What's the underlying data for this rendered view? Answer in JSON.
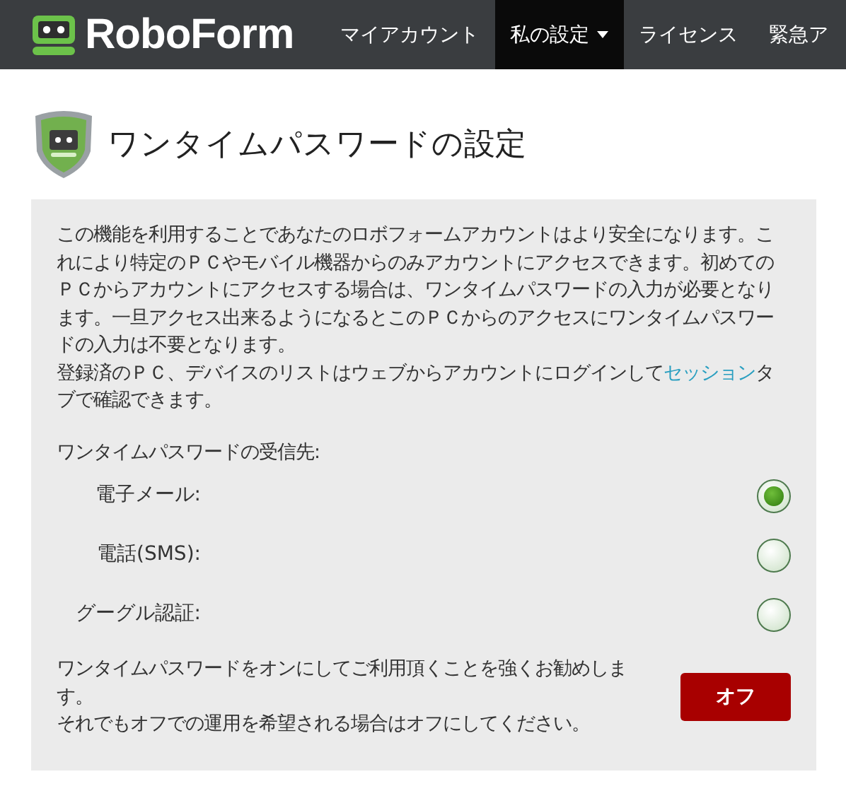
{
  "header": {
    "logo": "RoboForm",
    "nav": [
      {
        "label": "マイアカウント",
        "selected": false,
        "dropdown": false
      },
      {
        "label": "私の設定",
        "selected": true,
        "dropdown": true
      },
      {
        "label": "ライセンス",
        "selected": false,
        "dropdown": false
      },
      {
        "label": "緊急ア",
        "selected": false,
        "dropdown": false
      }
    ]
  },
  "title": "ワンタイムパスワードの設定",
  "panel": {
    "description": "この機能を利用することであなたのロボフォームアカウントはより安全になります。これにより特定のＰＣやモバイル機器からのみアカウントにアクセスできます。初めてのＰＣからアカウントにアクセスする場合は、ワンタイムパスワードの入力が必要となります。一旦アクセス出来るようになるとこのＰＣからのアクセスにワンタイムパスワードの入力は不要となります。",
    "note": {
      "before": "登録済のＰＣ、デバイスのリストはウェブからアカウントにログインして",
      "link": "セッション",
      "after": "タブで確認できます。"
    },
    "recipients_label": "ワンタイムパスワードの受信先:",
    "options": [
      {
        "label": "電子メール:",
        "selected": true
      },
      {
        "label": "電話(SMS):",
        "selected": false
      },
      {
        "label": "グーグル認証:",
        "selected": false
      }
    ],
    "recommendation": "ワンタイムパスワードをオンにしてご利用頂くことを強くお勧めします。",
    "recommendation_2": "それでもオフでの運用を希望される場合はオフにしてください。",
    "toggle": {
      "label": "オフ",
      "on": false
    }
  }
}
